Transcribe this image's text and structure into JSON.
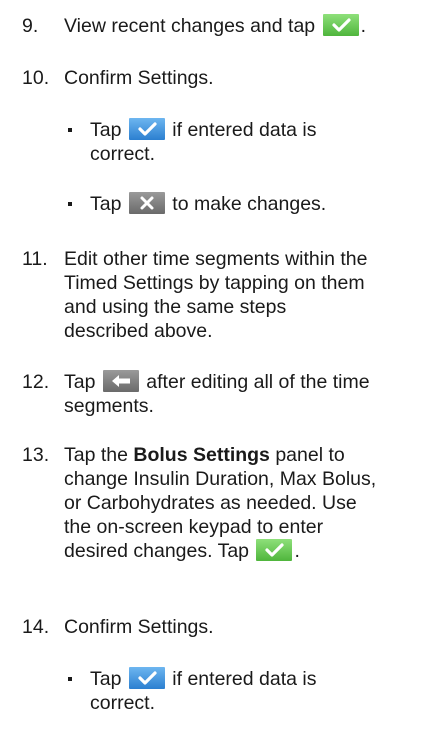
{
  "steps": [
    {
      "number": "9.",
      "text_before": "View recent changes and tap",
      "text_after": "."
    },
    {
      "number": "10.",
      "text": "Confirm Settings."
    },
    {
      "number": "11.",
      "line1": "Edit other time segments within the",
      "line2": "Timed Settings by tapping on them",
      "line3": "and using the same steps",
      "line4": "described above."
    },
    {
      "number": "12.",
      "text_before": "Tap",
      "text_after": "after editing all of the time",
      "line2": "segments."
    },
    {
      "number": "13.",
      "tap": "Tap the",
      "bold": "Bolus Settings",
      "after_bold": "panel to",
      "line2": "change Insulin Duration, Max Bolus,",
      "line3": "or Carbohydrates as needed. Use",
      "line4": "the on-screen keypad to enter",
      "line5_before": "desired changes. Tap",
      "line5_after": "."
    },
    {
      "number": "14.",
      "text": "Confirm Settings."
    }
  ],
  "bullets": {
    "a": {
      "tap": "Tap",
      "after": "if entered data is",
      "line2": "correct."
    },
    "b": {
      "tap": "Tap",
      "after": "to make changes."
    },
    "c": {
      "tap": "Tap",
      "after": "if entered data is",
      "line2": "correct."
    }
  },
  "icons": {
    "check_green": "check-icon",
    "check_blue": "check-icon",
    "close": "close-icon",
    "back": "back-arrow-icon"
  },
  "colors": {
    "check_green": "#5cc146",
    "check_blue": "#3a8edc",
    "gray_button": "#7a7a7a"
  }
}
